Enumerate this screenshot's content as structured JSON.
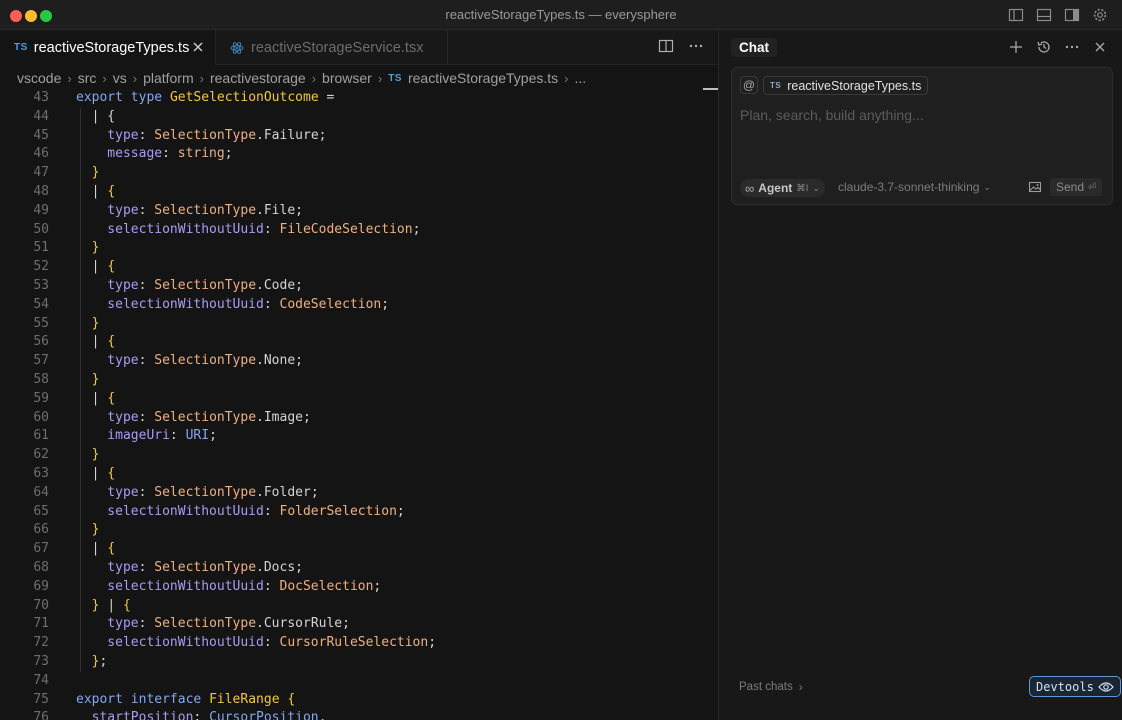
{
  "window": {
    "title": "reactiveStorageTypes.ts — everysphere"
  },
  "tabs": [
    {
      "label": "reactiveStorageTypes.ts",
      "badge": "TS",
      "active": true
    },
    {
      "label": "reactiveStorageService.tsx",
      "badge": "react",
      "active": false
    }
  ],
  "breadcrumb": {
    "items": [
      "vscode",
      "src",
      "vs",
      "platform",
      "reactivestorage",
      "browser"
    ],
    "file_badge": "TS",
    "file": "reactiveStorageTypes.ts",
    "ellipsis": "..."
  },
  "code_lines": [
    {
      "n": "43",
      "segs": [
        [
          "k",
          "export "
        ],
        [
          "k",
          "type "
        ],
        [
          "y",
          "GetSelectionOutcome "
        ],
        [
          "pu",
          "="
        ]
      ]
    },
    {
      "n": "44",
      "segs": [
        [
          "pu",
          "  | {"
        ]
      ]
    },
    {
      "n": "45",
      "segs": [
        [
          "pr",
          "    type"
        ],
        [
          "pu",
          ": "
        ],
        [
          "ty",
          "SelectionType"
        ],
        [
          "pu",
          ".Failure;"
        ]
      ]
    },
    {
      "n": "46",
      "segs": [
        [
          "pr",
          "    message"
        ],
        [
          "pu",
          ": "
        ],
        [
          "ty",
          "string"
        ],
        [
          "pu",
          ";"
        ]
      ]
    },
    {
      "n": "47",
      "segs": [
        [
          "y",
          "  }"
        ]
      ]
    },
    {
      "n": "48",
      "segs": [
        [
          "pu",
          "  | "
        ],
        [
          "y",
          "{"
        ]
      ]
    },
    {
      "n": "49",
      "segs": [
        [
          "pr",
          "    type"
        ],
        [
          "pu",
          ": "
        ],
        [
          "ty",
          "SelectionType"
        ],
        [
          "pu",
          ".File;"
        ]
      ]
    },
    {
      "n": "50",
      "segs": [
        [
          "pr",
          "    selectionWithoutUuid"
        ],
        [
          "pu",
          ": "
        ],
        [
          "ty",
          "FileCodeSelection"
        ],
        [
          "pu",
          ";"
        ]
      ]
    },
    {
      "n": "51",
      "segs": [
        [
          "y",
          "  }"
        ]
      ]
    },
    {
      "n": "52",
      "segs": [
        [
          "pu",
          "  | "
        ],
        [
          "y",
          "{"
        ]
      ]
    },
    {
      "n": "53",
      "segs": [
        [
          "pr",
          "    type"
        ],
        [
          "pu",
          ": "
        ],
        [
          "ty",
          "SelectionType"
        ],
        [
          "pu",
          ".Code;"
        ]
      ]
    },
    {
      "n": "54",
      "segs": [
        [
          "pr",
          "    selectionWithoutUuid"
        ],
        [
          "pu",
          ": "
        ],
        [
          "ty",
          "CodeSelection"
        ],
        [
          "pu",
          ";"
        ]
      ]
    },
    {
      "n": "55",
      "segs": [
        [
          "y",
          "  }"
        ]
      ]
    },
    {
      "n": "56",
      "segs": [
        [
          "pu",
          "  | "
        ],
        [
          "y",
          "{"
        ]
      ]
    },
    {
      "n": "57",
      "segs": [
        [
          "pr",
          "    type"
        ],
        [
          "pu",
          ": "
        ],
        [
          "ty",
          "SelectionType"
        ],
        [
          "pu",
          ".None;"
        ]
      ]
    },
    {
      "n": "58",
      "segs": [
        [
          "y",
          "  }"
        ]
      ]
    },
    {
      "n": "59",
      "segs": [
        [
          "pu",
          "  | "
        ],
        [
          "y",
          "{"
        ]
      ]
    },
    {
      "n": "60",
      "segs": [
        [
          "pr",
          "    type"
        ],
        [
          "pu",
          ": "
        ],
        [
          "ty",
          "SelectionType"
        ],
        [
          "pu",
          ".Image;"
        ]
      ]
    },
    {
      "n": "61",
      "segs": [
        [
          "pr",
          "    imageUri"
        ],
        [
          "pu",
          ": "
        ],
        [
          "k",
          "URI"
        ],
        [
          "pu",
          ";"
        ]
      ]
    },
    {
      "n": "62",
      "segs": [
        [
          "y",
          "  }"
        ]
      ]
    },
    {
      "n": "63",
      "segs": [
        [
          "pu",
          "  | "
        ],
        [
          "y",
          "{"
        ]
      ]
    },
    {
      "n": "64",
      "segs": [
        [
          "pr",
          "    type"
        ],
        [
          "pu",
          ": "
        ],
        [
          "ty",
          "SelectionType"
        ],
        [
          "pu",
          ".Folder;"
        ]
      ]
    },
    {
      "n": "65",
      "segs": [
        [
          "pr",
          "    selectionWithoutUuid"
        ],
        [
          "pu",
          ": "
        ],
        [
          "ty",
          "FolderSelection"
        ],
        [
          "pu",
          ";"
        ]
      ]
    },
    {
      "n": "66",
      "segs": [
        [
          "y",
          "  }"
        ]
      ]
    },
    {
      "n": "67",
      "segs": [
        [
          "pu",
          "  | "
        ],
        [
          "y",
          "{"
        ]
      ]
    },
    {
      "n": "68",
      "segs": [
        [
          "pr",
          "    type"
        ],
        [
          "pu",
          ": "
        ],
        [
          "ty",
          "SelectionType"
        ],
        [
          "pu",
          ".Docs;"
        ]
      ]
    },
    {
      "n": "69",
      "segs": [
        [
          "pr",
          "    selectionWithoutUuid"
        ],
        [
          "pu",
          ": "
        ],
        [
          "ty",
          "DocSelection"
        ],
        [
          "pu",
          ";"
        ]
      ]
    },
    {
      "n": "70",
      "segs": [
        [
          "y",
          "  } "
        ],
        [
          "pu",
          "| "
        ],
        [
          "y",
          "{"
        ]
      ]
    },
    {
      "n": "71",
      "segs": [
        [
          "pr",
          "    type"
        ],
        [
          "pu",
          ": "
        ],
        [
          "ty",
          "SelectionType"
        ],
        [
          "pu",
          ".CursorRule;"
        ]
      ]
    },
    {
      "n": "72",
      "segs": [
        [
          "pr",
          "    selectionWithoutUuid"
        ],
        [
          "pu",
          ": "
        ],
        [
          "ty",
          "CursorRuleSelection"
        ],
        [
          "pu",
          ";"
        ]
      ]
    },
    {
      "n": "73",
      "segs": [
        [
          "y",
          "  }"
        ],
        [
          "pu",
          ";"
        ]
      ]
    },
    {
      "n": "74",
      "segs": []
    },
    {
      "n": "75",
      "segs": [
        [
          "k",
          "export "
        ],
        [
          "k",
          "interface "
        ],
        [
          "y",
          "FileRange "
        ],
        [
          "y",
          "{"
        ]
      ]
    },
    {
      "n": "76",
      "segs": [
        [
          "pr",
          "  startPosition"
        ],
        [
          "pu",
          ": "
        ],
        [
          "k",
          "CursorPosition"
        ],
        [
          "pu",
          ","
        ]
      ]
    }
  ],
  "chat": {
    "title": "Chat",
    "context_at": "@",
    "file_chip_badge": "TS",
    "file_chip": "reactiveStorageTypes.ts",
    "input_placeholder": "Plan, search, build anything...",
    "input_value": "",
    "mode_icon": "∞",
    "mode_label": "Agent",
    "mode_shortcut": "⌘I",
    "model": "claude-3.7-sonnet-thinking",
    "send_label": "Send",
    "send_key": "⏎",
    "past_chats": "Past chats",
    "devtools": "Devtools"
  },
  "icons": {
    "titlebar": [
      "toggle-primary-sidebar-icon",
      "toggle-panel-icon",
      "toggle-secondary-sidebar-icon",
      "settings-gear-icon"
    ],
    "editor_actions": [
      "split-editor-icon",
      "more-actions-icon"
    ],
    "chat_actions": [
      "new-chat-icon",
      "chat-history-icon",
      "more-actions-icon",
      "close-icon"
    ]
  },
  "colors": {
    "keyword": "#83a7f2",
    "type_name": "#f2c744",
    "type_ref": "#efb080",
    "property": "#aa9bf5",
    "accent_devtools": "#5f96d8"
  }
}
